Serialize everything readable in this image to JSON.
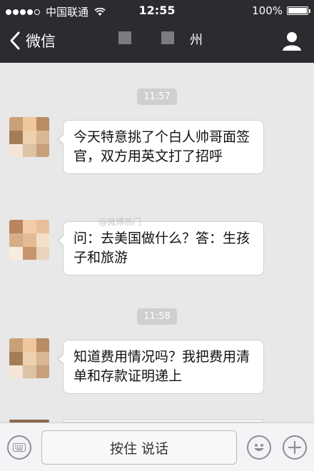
{
  "status_bar": {
    "carrier": "中国联通",
    "time": "12:55",
    "battery": "100%",
    "battery_level": 1.0
  },
  "nav": {
    "back_label": "微信",
    "title_visible": "州"
  },
  "messages": [
    {
      "type": "timestamp",
      "text": "11:57"
    },
    {
      "type": "bubble",
      "text": "今天特意挑了个白人帅哥面签官，双方用英文打了招呼"
    },
    {
      "type": "bubble",
      "text": "问：去美国做什么？答：生孩子和旅游"
    },
    {
      "type": "timestamp",
      "text": "11:58"
    },
    {
      "type": "bubble",
      "text": "知道费用情况吗？我把费用清单和存款证明递上"
    }
  ],
  "watermark": "@微博热门",
  "input_bar": {
    "talk_label": "按住 说话",
    "left_icon": "keyboard-icon",
    "emoji_icon": "smiley-icon",
    "plus_icon": "plus-icon"
  },
  "colors": {
    "nav_bg": "#2b2b30",
    "chat_bg": "#e8e8e8",
    "bubble_bg": "#ffffff",
    "timestamp_bg": "#cfcfcf"
  }
}
